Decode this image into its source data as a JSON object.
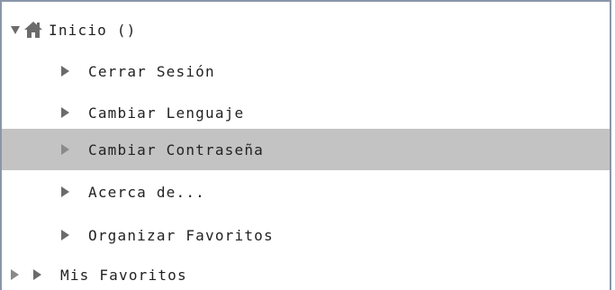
{
  "tree": {
    "root": {
      "label": "Inicio ()",
      "expand_icon": "triangle-down-icon",
      "icon": "home-icon"
    },
    "items": [
      {
        "label": "Cerrar Sesión",
        "icon": "triangle-right-icon",
        "selected": false
      },
      {
        "label": "Cambiar Lenguaje",
        "icon": "triangle-right-icon",
        "selected": false
      },
      {
        "label": "Cambiar Contraseña",
        "icon": "triangle-right-icon",
        "selected": true
      },
      {
        "label": "Acerca de...",
        "icon": "triangle-right-icon",
        "selected": false
      },
      {
        "label": "Organizar Favoritos",
        "icon": "triangle-right-icon",
        "selected": false
      },
      {
        "label": "Mis Favoritos",
        "icon": "triangle-right-icon",
        "selected": false,
        "expandable": true,
        "expand_icon": "triangle-right-icon"
      }
    ]
  },
  "colors": {
    "selected_background": "#c3c3c3",
    "border": "#8a96a8",
    "icon_gray": "#6b6b6b",
    "text": "#222222"
  }
}
